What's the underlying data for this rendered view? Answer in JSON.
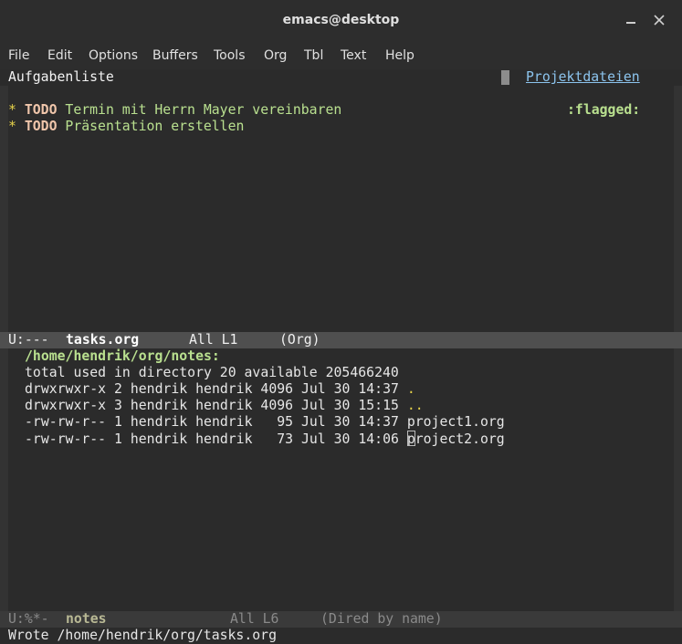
{
  "window": {
    "title": "emacs@desktop"
  },
  "menu": [
    "File",
    "Edit",
    "Options",
    "Buffers",
    "Tools",
    "Org",
    "Tbl",
    "Text",
    "Help"
  ],
  "top_pane": {
    "header_left": "Aufgabenliste",
    "header_right": "Projektdateien",
    "lines": [
      {
        "star": "*",
        "keyword": "TODO",
        "text": "Termin mit Herrn Mayer vereinbaren",
        "tag": ":flagged:"
      },
      {
        "star": "*",
        "keyword": "TODO",
        "text": "Präsentation erstellen",
        "tag": ""
      }
    ],
    "modeline": {
      "status": "U:---",
      "buffer": "tasks.org",
      "position": "All L1",
      "mode": "(Org)"
    }
  },
  "bottom_pane": {
    "header": "/home/hendrik/org/notes:",
    "total": "total used in directory 20 available 205466240",
    "rows": [
      {
        "perm": "drwxrwxr-x",
        "links": "2",
        "owner": "hendrik",
        "group": "hendrik",
        "size": "4096",
        "date": "Jul 30 14:37",
        "name": "."
      },
      {
        "perm": "drwxrwxr-x",
        "links": "3",
        "owner": "hendrik",
        "group": "hendrik",
        "size": "4096",
        "date": "Jul 30 15:15",
        "name": ".."
      },
      {
        "perm": "-rw-rw-r--",
        "links": "1",
        "owner": "hendrik",
        "group": "hendrik",
        "size": "  95",
        "date": "Jul 30 14:37",
        "name": "project1.org"
      },
      {
        "perm": "-rw-rw-r--",
        "links": "1",
        "owner": "hendrik",
        "group": "hendrik",
        "size": "  73",
        "date": "Jul 30 14:06",
        "name": "project2.org"
      }
    ],
    "modeline": {
      "status": "U:%*-",
      "buffer": "notes",
      "position": "All L6",
      "mode": "(Dired by name)"
    }
  },
  "echo_area": "Wrote /home/hendrik/org/tasks.org",
  "colors": {
    "background": "#2b2b2b",
    "todo": "#f0c6ab",
    "heading": "#b9e08f",
    "link": "#8cc4ee",
    "star": "#e6d24a"
  }
}
